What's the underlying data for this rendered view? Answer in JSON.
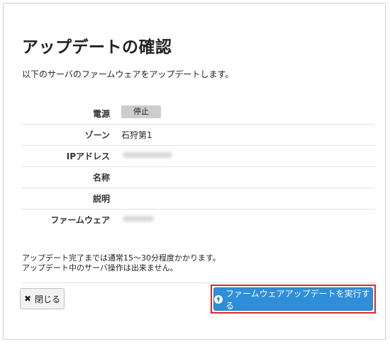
{
  "dialog": {
    "title": "アップデートの確認",
    "description": "以下のサーバのファームウェアをアップデートします。"
  },
  "server": {
    "fields": [
      {
        "label": "電源",
        "value": "停止"
      },
      {
        "label": "ゾーン",
        "value": "石狩第1"
      },
      {
        "label": "IPアドレス",
        "value": ""
      },
      {
        "label": "名称",
        "value": ""
      },
      {
        "label": "説明",
        "value": ""
      },
      {
        "label": "ファームウェア",
        "value": ""
      }
    ]
  },
  "notice": {
    "line1": "アップデート完了までは通常15～30分程度かかります。",
    "line2": "アップデート中のサーバ操作は出来ません。"
  },
  "buttons": {
    "close_label": "閉じる",
    "run_label": "ファームウェアアップデートを実行する"
  },
  "icons": {
    "close": "close-icon",
    "run": "arrow-circle-up-icon"
  },
  "colors": {
    "primary": "#2f8ed8",
    "highlight": "#d22a2a",
    "badge": "#cdcdcd"
  }
}
